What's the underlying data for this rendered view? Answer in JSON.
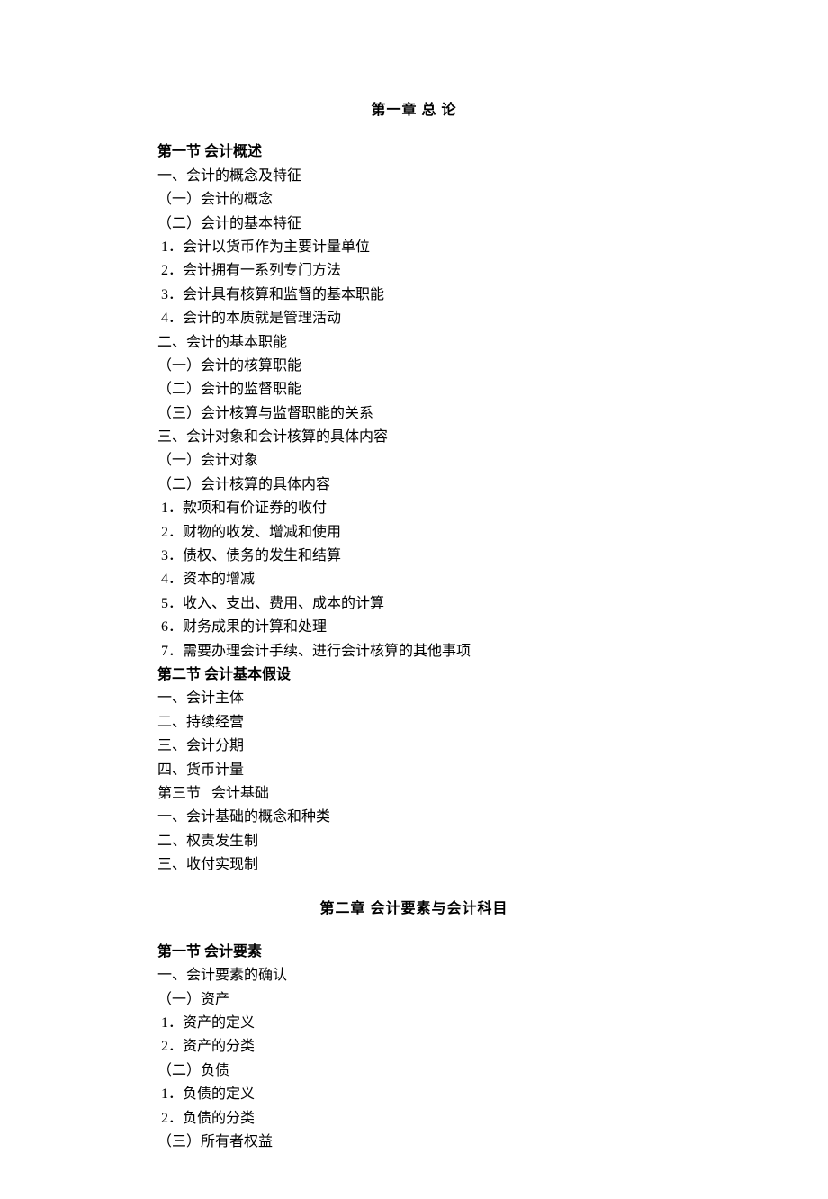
{
  "chapter1": {
    "title": "第一章   总       论",
    "section1": {
      "title": "第一节   会计概述",
      "items": [
        "一、会计的概念及特征",
        "（一）会计的概念",
        "（二）会计的基本特征",
        " 1．会计以货币作为主要计量单位",
        " 2．会计拥有一系列专门方法",
        " 3．会计具有核算和监督的基本职能",
        " 4．会计的本质就是管理活动",
        "二、会计的基本职能",
        "（一）会计的核算职能",
        "（二）会计的监督职能",
        "（三）会计核算与监督职能的关系",
        "三、会计对象和会计核算的具体内容",
        "（一）会计对象",
        "（二）会计核算的具体内容",
        " 1．款项和有价证券的收付",
        " 2．财物的收发、增减和使用",
        " 3．债权、债务的发生和结算",
        " 4．资本的增减",
        " 5．收入、支出、费用、成本的计算",
        " 6．财务成果的计算和处理",
        " 7．需要办理会计手续、进行会计核算的其他事项"
      ]
    },
    "section2": {
      "title": " 第二节   会计基本假设",
      "items": [
        "一、会计主体",
        "二、持续经营",
        "三、会计分期",
        "四、货币计量"
      ]
    },
    "section3": {
      "title": "第三节   会计基础",
      "items": [
        "一、会计基础的概念和种类",
        "二、权责发生制",
        "三、收付实现制"
      ]
    }
  },
  "chapter2": {
    "title": "第二章   会计要素与会计科目",
    "section1": {
      "title": "第一节   会计要素",
      "items": [
        "一、会计要素的确认",
        "（一）资产",
        " 1．资产的定义",
        " 2．资产的分类",
        "（二）负债",
        " 1．负债的定义",
        " 2．负债的分类",
        "（三）所有者权益"
      ]
    }
  }
}
